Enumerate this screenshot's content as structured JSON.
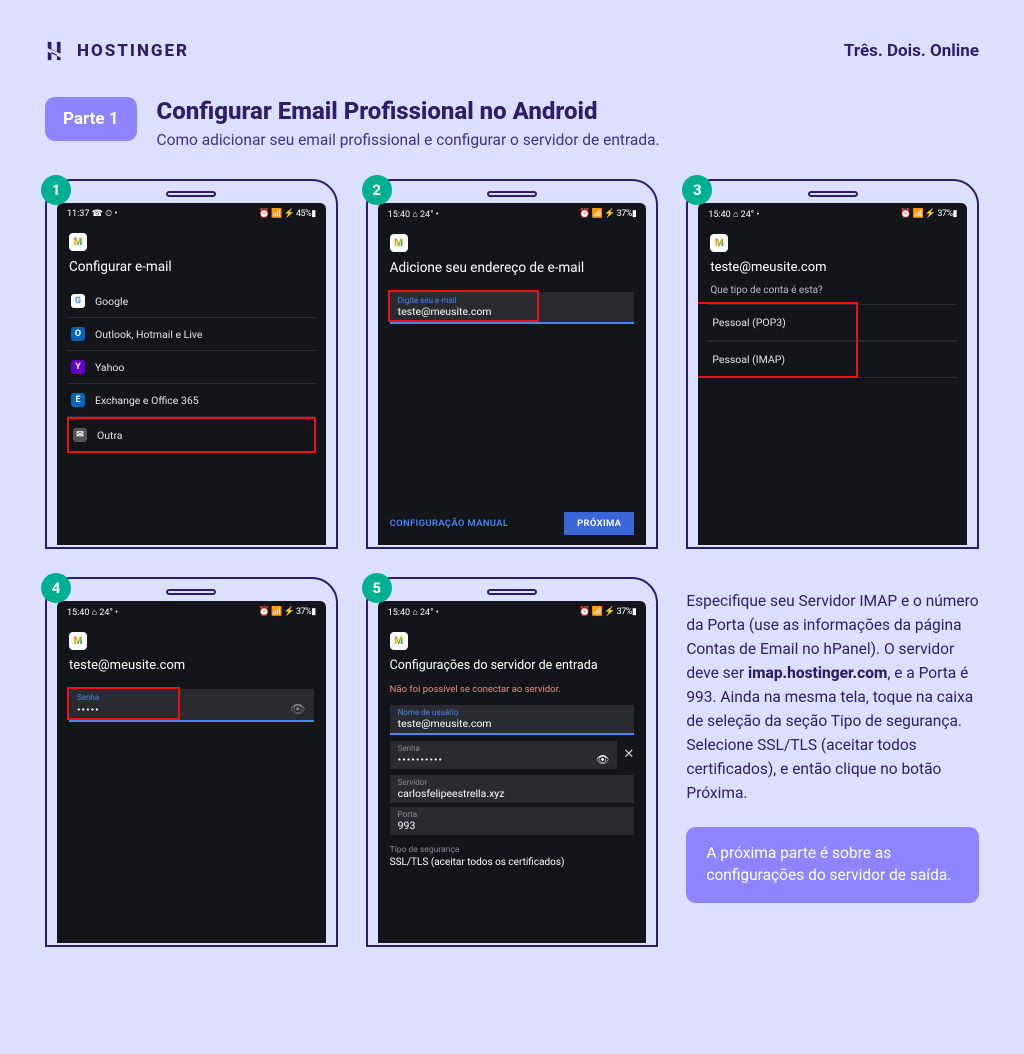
{
  "brand": {
    "name": "HOSTINGER",
    "tagline": "Três. Dois. Online"
  },
  "part_badge": "Parte 1",
  "title": "Configurar Email Profissional no Android",
  "subtitle": "Como adicionar seu email profissional e configurar o servidor de entrada.",
  "steps": {
    "s1": {
      "num": "1",
      "time": "11:37",
      "status_left_extra": "☎ ⏲ •",
      "status_right": "⏰ 📶 ⚡ 45%▮",
      "heading": "Configurar e-mail",
      "providers": [
        {
          "label": "Google",
          "color": "#fff"
        },
        {
          "label": "Outlook, Hotmail e Live",
          "color": "#0364b8"
        },
        {
          "label": "Yahoo",
          "color": "#6001d2"
        },
        {
          "label": "Exchange e Office 365",
          "color": "#0364b8"
        },
        {
          "label": "Outra",
          "color": "#555"
        }
      ]
    },
    "s2": {
      "num": "2",
      "time": "15:40",
      "status_left_extra": "⌂ 24° •",
      "status_right": "⏰ 📶 ⚡ 37%▮",
      "heading": "Adicione seu endereço de e-mail",
      "field_label": "Digite seu e-mail",
      "field_value": "teste@meusite.com",
      "manual": "CONFIGURAÇÃO MANUAL",
      "next": "PRÓXIMA"
    },
    "s3": {
      "num": "3",
      "time": "15:40",
      "status_left_extra": "⌂ 24° •",
      "status_right": "⏰ 📶 ⚡ 37%▮",
      "heading": "teste@meusite.com",
      "subq": "Que tipo de conta é esta?",
      "opt1": "Pessoal (POP3)",
      "opt2": "Pessoal (IMAP)"
    },
    "s4": {
      "num": "4",
      "time": "15:40",
      "status_left_extra": "⌂ 24° •",
      "status_right": "⏰ 📶 ⚡ 37%▮",
      "heading": "teste@meusite.com",
      "pw_label": "Senha",
      "pw_value": "•••••"
    },
    "s5": {
      "num": "5",
      "time": "15:40",
      "status_left_extra": "⌂ 24° •",
      "status_right": "⏰ 📶 ⚡ 37%▮",
      "heading": "Configurações do servidor de entrada",
      "error": "Não foi possível se conectar ao servidor.",
      "user_label": "Nome de usuário",
      "user_value": "teste@meusite.com",
      "pw_label": "Senha",
      "pw_value": "••••••••••",
      "server_label": "Servidor",
      "server_value": "carlosfelipeestrella.xyz",
      "port_label": "Porta",
      "port_value": "993",
      "sectype_label": "Tipo de segurança",
      "sectype_value": "SSL/TLS (aceitar todos os certificados)"
    }
  },
  "instructions": {
    "pre": "Especifique seu Servidor IMAP e o número da Porta (use as informações da página Contas de Email no hPanel). O servidor deve ser ",
    "bold": "imap.hostinger.com",
    "post": ", e a Porta é 993. Ainda na mesma tela, toque na caixa de seleção da seção Tipo de segurança. Selecione SSL/TLS (aceitar todos certificados), e então clique no botão Próxima."
  },
  "next_part": "A próxima parte é sobre as configurações do servidor de saída."
}
